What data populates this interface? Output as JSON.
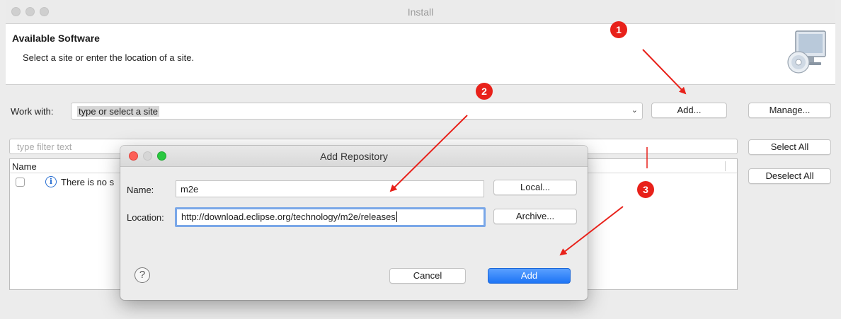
{
  "window": {
    "title": "Install"
  },
  "header": {
    "title": "Available Software",
    "subtitle": "Select a site or enter the location of a site."
  },
  "work_with": {
    "label": "Work with:",
    "value": "type or select a site"
  },
  "buttons": {
    "add": "Add...",
    "manage": "Manage...",
    "select_all": "Select All",
    "deselect_all": "Deselect All"
  },
  "filter": {
    "placeholder": "type filter text"
  },
  "table": {
    "column_name": "Name",
    "row_text": "There is no s"
  },
  "dialog": {
    "title": "Add Repository",
    "name_label": "Name:",
    "name_value": "m2e",
    "location_label": "Location:",
    "location_value": "http://download.eclipse.org/technology/m2e/releases",
    "local_button": "Local...",
    "archive_button": "Archive...",
    "cancel_button": "Cancel",
    "add_button": "Add",
    "help_glyph": "?"
  },
  "annotations": {
    "step1": "1",
    "step2": "2",
    "step3": "3",
    "color": "#e8211a"
  },
  "icons": {
    "info": "info-icon",
    "help": "help-icon",
    "dropdown": "chevron-down-icon",
    "monitor": "monitor-cd-icon"
  }
}
